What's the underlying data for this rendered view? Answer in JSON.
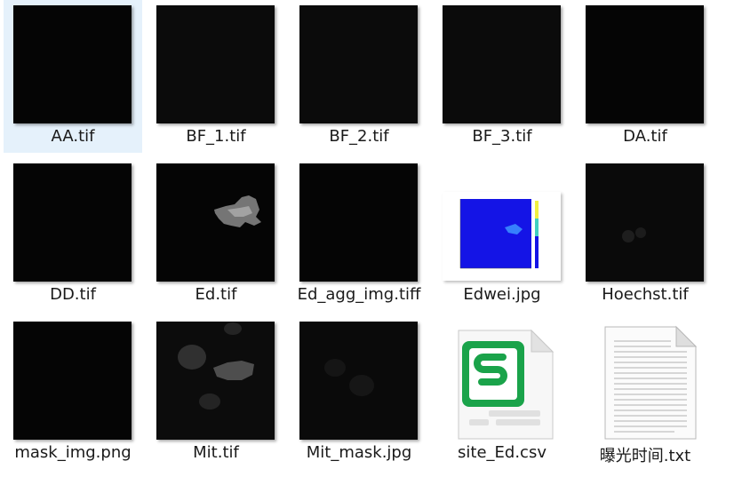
{
  "files": [
    {
      "name": "AA.tif"
    },
    {
      "name": "BF_1.tif"
    },
    {
      "name": "BF_2.tif"
    },
    {
      "name": "BF_3.tif"
    },
    {
      "name": "DA.tif"
    },
    {
      "name": "DD.tif"
    },
    {
      "name": "Ed.tif"
    },
    {
      "name": "Ed_agg_img.tiff"
    },
    {
      "name": "Edwei.jpg"
    },
    {
      "name": "Hoechst.tif"
    },
    {
      "name": "mask_img.png"
    },
    {
      "name": "Mit.tif"
    },
    {
      "name": "Mit_mask.jpg"
    },
    {
      "name": "site_Ed.csv"
    },
    {
      "name": "曝光时间.txt"
    }
  ],
  "icons": {
    "csv": "spreadsheet-file-icon",
    "txt": "text-file-icon"
  },
  "colors": {
    "selection": "#e5f1fb",
    "csv_accent": "#1aa34a",
    "heatmap_bg": "#1414e6"
  }
}
